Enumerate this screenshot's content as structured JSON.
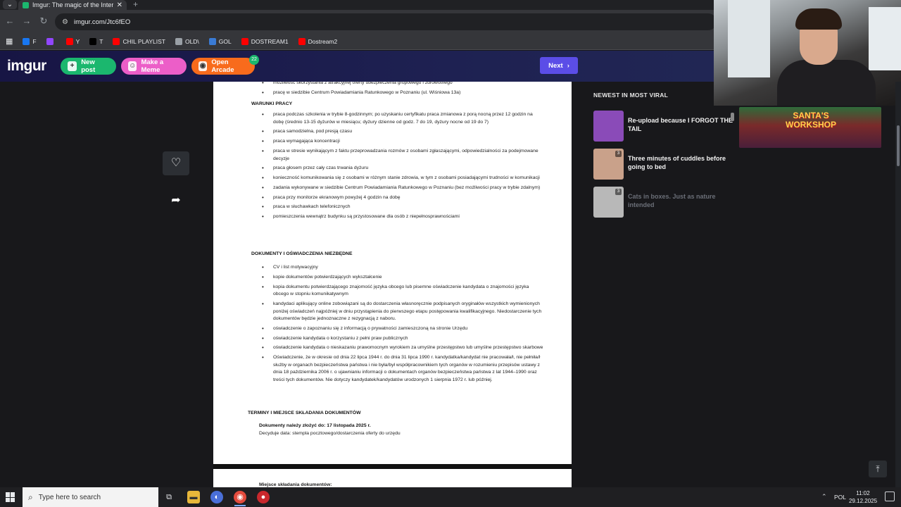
{
  "browser": {
    "tab_title": "Imgur: The magic of the Interne",
    "url": "imgur.com/Jtc6fEO",
    "bookmarks": [
      {
        "label": "F",
        "color": "#1877f2"
      },
      {
        "label": "",
        "color": "#9146ff"
      },
      {
        "label": "Y",
        "color": "#ff0000"
      },
      {
        "label": "T",
        "color": "#000000"
      },
      {
        "label": "CHIL PLAYLIST",
        "color": "#ff0000"
      },
      {
        "label": "OLD\\",
        "color": "#9aa0a6"
      },
      {
        "label": "GOL",
        "color": "#3a7bd5"
      },
      {
        "label": "DOSTREAM1",
        "color": "#ff0000"
      },
      {
        "label": "Dostream2",
        "color": "#ff0000"
      }
    ]
  },
  "imgur": {
    "logo": "imgur",
    "new_post": "New post",
    "make_meme": "Make a Meme",
    "open_arcade": "Open Arcade",
    "arcade_badge": "22",
    "next": "Next"
  },
  "document": {
    "top_items": [
      "możliwość skorzystania z atrakcyjnej oferty ubezpieczenia grupowego i zdrowotnego",
      "pracę w siedzibie Centrum Powiadamiania Ratunkowego w Poznaniu (ul. Wiśniowa 13a)"
    ],
    "warunki_title": "WARUNKI PRACY",
    "warunki_items": [
      "praca podczas szkolenia w trybie 8-godzinnym; po uzyskaniu certyfikatu praca zmianowa z porą nocną przez 12 godzin na dobę (średnio 13-15 dyżurów w miesiącu; dyżury dzienne od godz. 7 do 19, dyżury nocne od 19 do 7)",
      "praca samodzielna, pod presją czasu",
      "praca wymagająca koncentracji",
      "praca w stresie wynikającym z faktu przeprowadzania rozmów z osobami zgłaszającymi, odpowiedzialności za podejmowane decyzje",
      "praca głosem przez cały czas trwania dyżuru",
      "konieczność komunikowania się z osobami w różnym stanie zdrowia, w tym z osobami posiadającymi trudności w komunikacji",
      "zadania wykonywane w siedzibie Centrum Powiadamiania Ratunkowego w Poznaniu (bez możliwości pracy w trybie zdalnym)",
      "praca przy monitorze ekranowym powyżej 4 godzin na dobę",
      "praca w słuchawkach telefonicznych",
      "pomieszczenia wewnątrz budynku są przystosowane dla osób z niepełnosprawnościami"
    ],
    "dokumenty_title": "DOKUMENTY I OŚWIADCZENIA NIEZBĘDNE",
    "dokumenty_items": [
      "CV i list motywacyjny",
      "kopie dokumentów potwierdzających wykształcenie",
      "kopia dokumentu potwierdzającego znajomość języka obcego lub pisemne oświadczenie kandydata o znajomości języka obcego w stopniu komunikatywnym",
      "kandydaci aplikujący online zobowiązani są do dostarczenia własnoręcznie podpisanych oryginałów wszystkich wymienionych poniżej oświadczeń najpóźniej w dniu przystąpienia do pierwszego etapu postępowania kwalifikacyjnego. Niedostarczenie tych dokumentów będzie jednoznaczne z rezygnacją z naboru.",
      "oświadczenie o zapoznaniu się z informacją o prywatności zamieszczoną na stronie Urzędu",
      "oświadczenie kandydata o korzystaniu z pełni praw publicznych",
      "oświadczenie kandydata o nieskazaniu prawomocnym wyrokiem za umyślne przestępstwo lub umyślne przestępstwo skarbowe",
      "Oświadczenie, że w okresie od dnia 22 lipca 1944 r. do dnia 31 lipca 1990 r. kandydatka/kandydat nie pracowała/ł, nie pełniła/ł służby w organach bezpieczeństwa państwa i nie była/był współpracownikiem tych organów w rozumieniu przepisów ustawy z dnia 18 października 2006 r. o ujawnianiu informacji o dokumentach organów bezpieczeństwa państwa z lat 1944–1990 oraz treści tych dokumentów. Nie dotyczy kandydatek/kandydatów urodzonych 1 sierpnia 1972 r. lub później."
    ],
    "terminy_title": "TERMINY I MIEJSCE SKŁADANIA DOKUMENTÓW",
    "deadline": "Dokumenty należy złożyć do: 17 listopada 2025 r.",
    "decides": "Decyduje data: stempla pocztowego/dostarczenia oferty do urzędu",
    "next_page_heading": "Miejsce składania dokumentów:"
  },
  "sidebar": {
    "title": "NEWEST IN MOST VIRAL",
    "posts": [
      {
        "title": "Re-upload because I FORGOT THE TAIL",
        "count": "",
        "thumb_color": "#8a4bb8"
      },
      {
        "title": "Three minutes of cuddles before going to bed",
        "count": "3",
        "thumb_color": "#c9a18a"
      },
      {
        "title": "Cats in boxes. Just as nature intended",
        "count": "3",
        "thumb_color": "#b8b8b8"
      }
    ],
    "ad_text": "SANTA'S WORKSHOP"
  },
  "taskbar": {
    "search_placeholder": "Type here to search",
    "lang": "POL",
    "time": "11:02",
    "date": "29.12.2025"
  },
  "colors": {
    "new_post": "#1bb76e",
    "make_meme": "#ec5ec8",
    "open_arcade": "#f86b1c",
    "next": "#5b4de7"
  }
}
